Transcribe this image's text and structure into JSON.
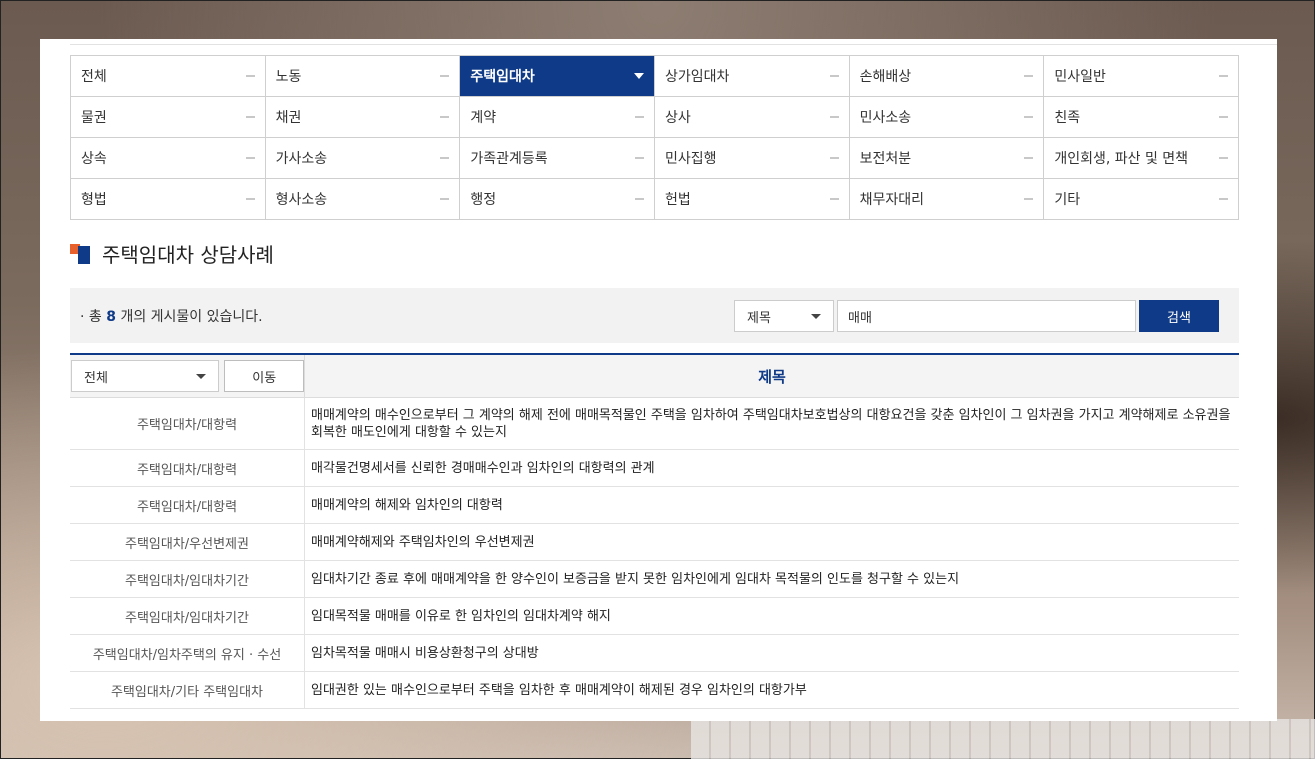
{
  "categories": [
    "전체",
    "노동",
    "주택임대차",
    "상가임대차",
    "손해배상",
    "민사일반",
    "물권",
    "채권",
    "계약",
    "상사",
    "민사소송",
    "친족",
    "상속",
    "가사소송",
    "가족관계등록",
    "민사집행",
    "보전처분",
    "개인회생, 파산 및 면책",
    "형법",
    "형사소송",
    "행정",
    "헌법",
    "채무자대리",
    "기타"
  ],
  "active_category": "주택임대차",
  "section_title": "주택임대차 상담사례",
  "summary": {
    "prefix": "총",
    "count": "8",
    "suffix": "개의 게시물이 있습니다."
  },
  "search": {
    "field_label": "제목",
    "query": "매매",
    "button": "검색"
  },
  "filter": {
    "category_label": "전체",
    "move_button": "이동"
  },
  "table": {
    "title_header": "제목",
    "rows": [
      {
        "category": "주택임대차/대항력",
        "title": "매매계약의 매수인으로부터 그 계약의 해제 전에 매매목적물인 주택을 임차하여 주택임대차보호법상의 대항요건을 갖춘 임차인이 그 임차권을 가지고 계약해제로 소유권을 회복한 매도인에게 대항할 수 있는지"
      },
      {
        "category": "주택임대차/대항력",
        "title": "매각물건명세서를 신뢰한 경매매수인과 임차인의 대항력의 관계"
      },
      {
        "category": "주택임대차/대항력",
        "title": "매매계약의 해제와 임차인의 대항력"
      },
      {
        "category": "주택임대차/우선변제권",
        "title": "매매계약해제와 주택임차인의 우선변제권"
      },
      {
        "category": "주택임대차/임대차기간",
        "title": "임대차기간 종료 후에 매매계약을 한 양수인이 보증금을 받지 못한 임차인에게 임대차 목적물의 인도를 청구할 수 있는지"
      },
      {
        "category": "주택임대차/임대차기간",
        "title": "임대목적물 매매를 이유로 한 임차인의 임대차계약 해지"
      },
      {
        "category": "주택임대차/임차주택의 유지 · 수선",
        "title": "임차목적물 매매시 비용상환청구의 상대방"
      },
      {
        "category": "주택임대차/기타 주택임대차",
        "title": "임대권한 있는 매수인으로부터 주택을 임차한 후 매매계약이 해제된 경우 임차인의 대항가부"
      }
    ]
  }
}
